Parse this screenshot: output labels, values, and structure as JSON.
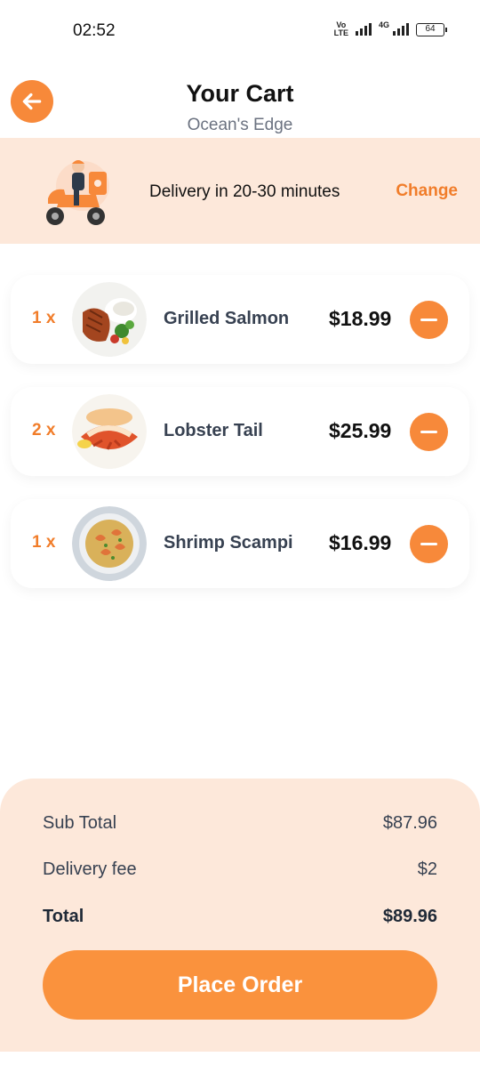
{
  "status_bar": {
    "time": "02:52",
    "volte_top": "Vo",
    "volte_bottom": "LTE",
    "network_label": "4G",
    "battery": "64"
  },
  "header": {
    "title": "Your Cart",
    "subtitle": "Ocean's Edge",
    "back_icon": "arrow-left-icon"
  },
  "delivery": {
    "text": "Delivery in 20-30 minutes",
    "change_label": "Change",
    "illustration": "delivery-scooter-icon"
  },
  "cart": {
    "items": [
      {
        "qty": "1 x",
        "name": "Grilled Salmon",
        "price": "$18.99"
      },
      {
        "qty": "2 x",
        "name": "Lobster Tail",
        "price": "$25.99"
      },
      {
        "qty": "1 x",
        "name": "Shrimp Scampi",
        "price": "$16.99"
      }
    ]
  },
  "summary": {
    "subtotal_label": "Sub Total",
    "subtotal_value": "$87.96",
    "delivery_fee_label": "Delivery fee",
    "delivery_fee_value": "$2",
    "total_label": "Total",
    "total_value": "$89.96",
    "place_order_label": "Place Order"
  },
  "colors": {
    "accent": "#f7893a",
    "accent_text": "#f17d2a",
    "banner_bg": "#fde8da"
  }
}
